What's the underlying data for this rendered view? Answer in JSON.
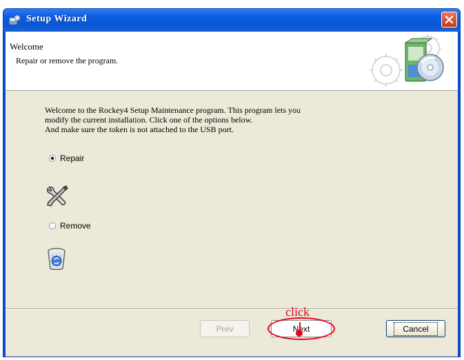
{
  "window": {
    "title": "Setup Wizard",
    "close_icon": "close-icon"
  },
  "header": {
    "title": "Welcome",
    "subtitle": "Repair or remove the program."
  },
  "body": {
    "welcome_lines": [
      "Welcome to the Rockey4 Setup Maintenance program. This program lets you",
      "modify the current installation. Click one of the options below.",
      "And make sure the token is not attached to the USB port."
    ],
    "options": [
      {
        "label": "Repair",
        "selected": true,
        "icon": "tools-icon"
      },
      {
        "label": "Remove",
        "selected": false,
        "icon": "recycle-bin-icon"
      }
    ]
  },
  "footer": {
    "prev_label": "Prev",
    "prev_enabled": false,
    "next_label": "Next",
    "cancel_label": "Cancel"
  },
  "annotation": {
    "text": "click",
    "color": "#e5001e"
  },
  "colors": {
    "titlebar": "#0a5ce2",
    "dialog_bg": "#ece9d8",
    "close_button": "#c73a19"
  }
}
